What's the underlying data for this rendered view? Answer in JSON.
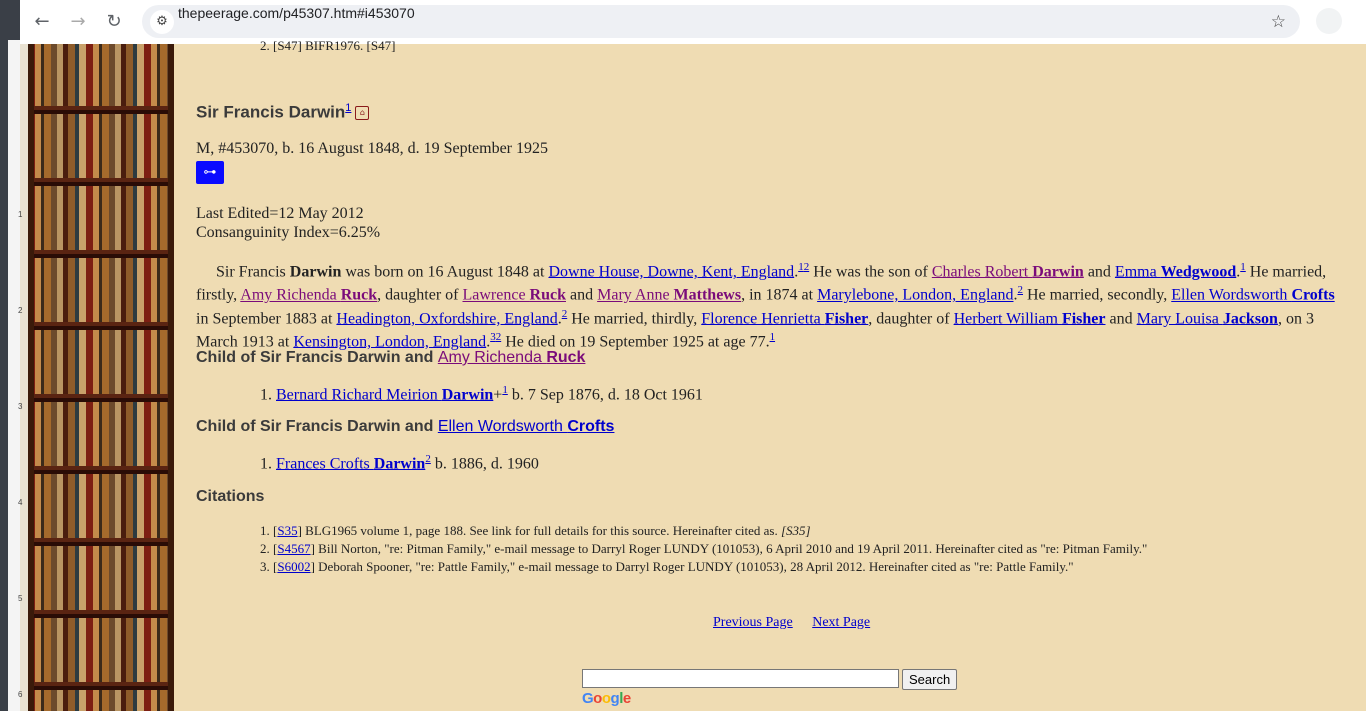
{
  "browser": {
    "url": "thepeerage.com/p45307.htm#i453070",
    "back_icon": "←",
    "forward_icon": "→",
    "reload_icon": "↻",
    "site_info_icon": "⚙",
    "bookmark_icon": "☆"
  },
  "left_ruler": [
    "1",
    "2",
    "3",
    "4",
    "5",
    "6"
  ],
  "top_fragment": "2. [S47] BIFR1976. [S47]",
  "person": {
    "name": "Sir Francis Darwin",
    "name_sup": "1",
    "meta": "M, #453070, b. 16 August 1848, d. 19 September 1925",
    "tree_icon": "⊶",
    "last_edited": "Last Edited=12 May 2012",
    "consanguinity": "Consanguinity Index=6.25%"
  },
  "bio": {
    "p1": "Sir Francis ",
    "surname": "Darwin",
    "p2": " was born on 16 August 1848 at ",
    "place_birth": "Downe House, Downe, Kent, England",
    "s1": "1",
    "s2": "2",
    "p3": " He was the son of ",
    "father_given": "Charles Robert ",
    "father_surname": "Darwin",
    "p4": " and ",
    "mother_given": "Emma ",
    "mother_surname": "Wedgwood",
    "s3": "1",
    "p5": " He married, firstly, ",
    "wife1_given": "Amy Richenda ",
    "wife1_surname": "Ruck",
    "p6": ", daughter of ",
    "w1f_given": "Lawrence ",
    "w1f_surname": "Ruck",
    "p7": " and ",
    "w1m_given": "Mary Anne ",
    "w1m_surname": "Matthews",
    "p8": ", in 1874 at ",
    "place_m1": "Marylebone, London, England",
    "s4": "2",
    "p9": " He married, secondly, ",
    "wife2_given": "Ellen Wordsworth ",
    "wife2_surname": "Crofts",
    "p10": " in September 1883 at ",
    "place_m2": "Headington, Oxfordshire, England",
    "s5": "2",
    "p11": " He married, thirdly, ",
    "wife3_given": "Florence Henrietta ",
    "wife3_surname": "Fisher",
    "p12": ", daughter of ",
    "w3f_given": "Herbert William ",
    "w3f_surname": "Fisher",
    "p13": " and ",
    "w3m_given": "Mary Louisa ",
    "w3m_surname": "Jackson",
    "p14": ", on 3 March 1913 at ",
    "place_m3": "Kensington, London, England",
    "s6": "3",
    "s7": "2",
    "p15": " He died on 19 September 1925 at age 77.",
    "s8": "1"
  },
  "children": [
    {
      "heading": "Child of Sir Francis Darwin and ",
      "parent_given": "Amy Richenda ",
      "parent_surname": "Ruck",
      "num": "1. ",
      "child_given": "Bernard Richard Meirion ",
      "child_surname": "Darwin",
      "plus": "+",
      "sup": "1",
      "dates": " b. 7 Sep 1876, d. 18 Oct 1961"
    },
    {
      "heading": "Child of Sir Francis Darwin and ",
      "parent_given": "Ellen Wordsworth ",
      "parent_surname": "Crofts",
      "num": "1. ",
      "child_given": "Frances Crofts ",
      "child_surname": "Darwin",
      "plus": "",
      "sup": "2",
      "dates": " b. 1886, d. 1960"
    }
  ],
  "citations": {
    "heading": "Citations",
    "items": [
      {
        "num": "1. [",
        "id": "S35",
        "text": "] BLG1965 volume 1, page 188. See link for full details for this source. Hereinafter cited as. ",
        "tail": "[S35]"
      },
      {
        "num": "2. [",
        "id": "S4567",
        "text": "] Bill Norton, \"re: Pitman Family,\" e-mail message to Darryl Roger LUNDY (101053), 6 April 2010 and 19 April 2011. Hereinafter cited as \"re: Pitman Family.\"",
        "tail": ""
      },
      {
        "num": "3. [",
        "id": "S6002",
        "text": "] Deborah Spooner, \"re: Pattle Family,\" e-mail message to Darryl Roger LUNDY (101053), 28 April 2012. Hereinafter cited as \"re: Pattle Family.\"",
        "tail": ""
      }
    ]
  },
  "pager": {
    "prev": "Previous Page",
    "next": "Next Page"
  },
  "search": {
    "button": "Search",
    "logo": [
      "G",
      "o",
      "o",
      "g",
      "l",
      "e"
    ]
  },
  "colors": {
    "link": "#0000cc",
    "visited": "#7a0b7a",
    "page_bg": "#efdcb3",
    "tree_button": "#0a0aff"
  }
}
